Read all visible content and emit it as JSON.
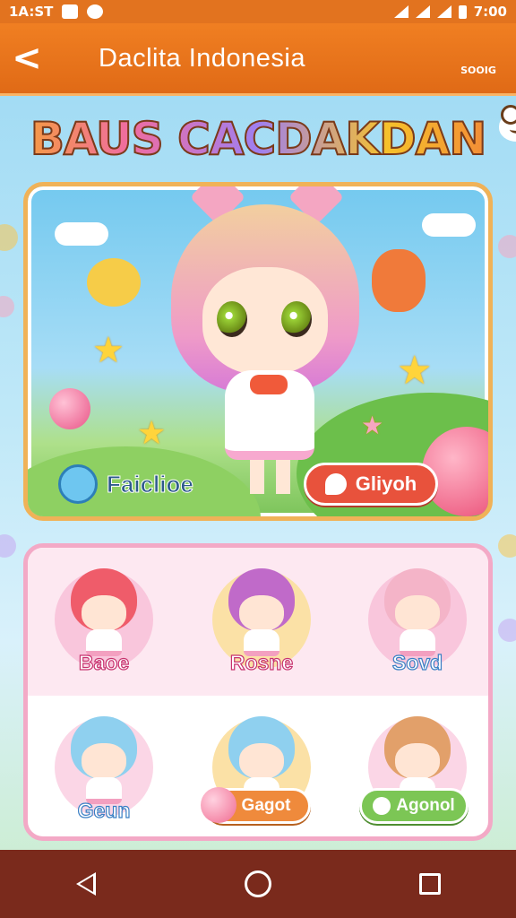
{
  "status_bar": {
    "time": "1A:ST",
    "clock": "7:00"
  },
  "app_bar": {
    "title": "Daclita Indonesia",
    "back_label": "<",
    "mascot_caption": "SOOIG"
  },
  "headline": "BAUS CACDAKDAN",
  "hero": {
    "left_button_label": "Faiclioe",
    "right_button_label": "Gliyoh"
  },
  "characters": [
    {
      "label": "Baoe"
    },
    {
      "label": "Rosne"
    },
    {
      "label": "Sovd"
    },
    {
      "label": "Geun"
    },
    {
      "label": "Gagot"
    },
    {
      "label": "Agonol"
    }
  ],
  "nav": {
    "back": "back",
    "home": "home",
    "recents": "recents"
  },
  "colors": {
    "accent": "#e2731f",
    "card_border": "#f0b258",
    "grid_border": "#f3a9c6",
    "nav_bg": "#7a2a1c"
  },
  "icons": [
    "signal-icon",
    "battery-icon",
    "frog-mascot-icon",
    "back-arrow-icon",
    "triangle-back-icon",
    "circle-home-icon",
    "square-recents-icon"
  ]
}
